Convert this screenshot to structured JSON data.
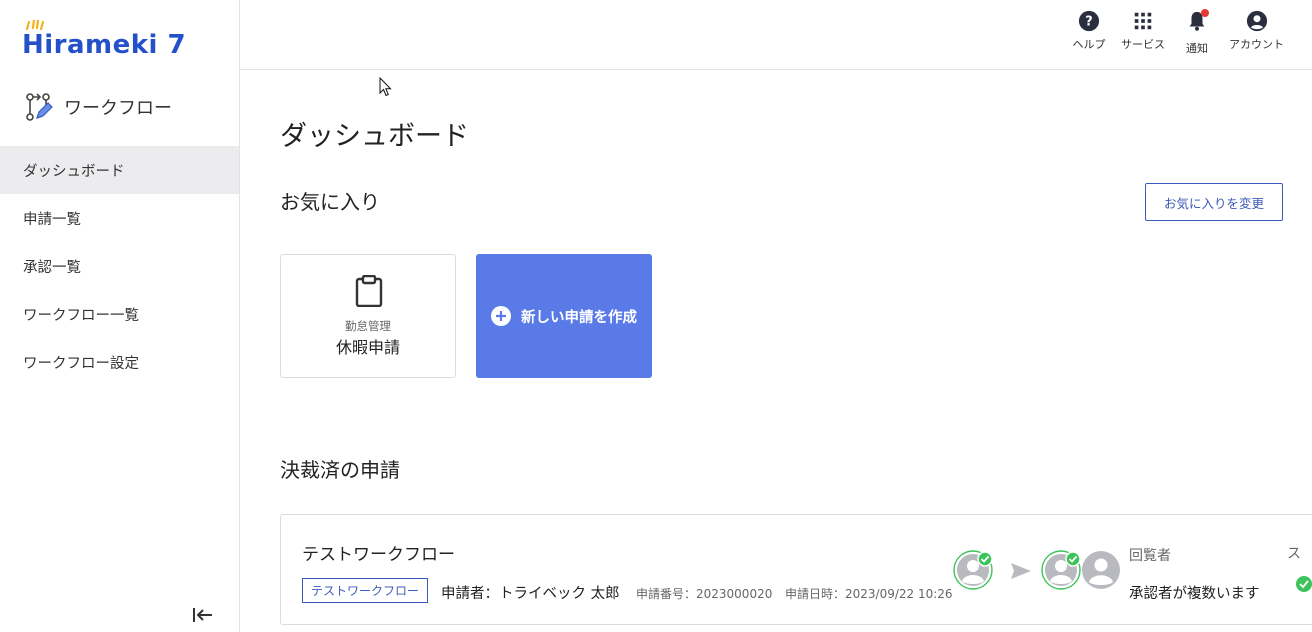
{
  "brand": {
    "logo_text": "Hirameki 7",
    "app_name": "ワークフロー"
  },
  "sidebar": {
    "items": [
      {
        "label": "ダッシュボード",
        "active": true
      },
      {
        "label": "申請一覧"
      },
      {
        "label": "承認一覧"
      },
      {
        "label": "ワークフロー一覧"
      },
      {
        "label": "ワークフロー設定"
      }
    ],
    "collapse_icon": "collapse-left-icon"
  },
  "header": {
    "help_label": "ヘルプ",
    "services_label": "サービス",
    "notifications_label": "通知",
    "account_label": "アカウント",
    "notification_dot_color": "#e53935"
  },
  "main": {
    "page_title": "ダッシュボード",
    "favorites": {
      "title": "お気に入り",
      "change_button": "お気に入りを変更",
      "cards": [
        {
          "category": "勤怠管理",
          "name": "休暇申請",
          "icon": "clipboard-icon"
        }
      ],
      "new_request_label": "新しい申請を作成"
    },
    "completed": {
      "title": "決裁済の申請",
      "items": [
        {
          "title": "テストワークフロー",
          "tag": "テストワークフロー",
          "applicant": "申請者：トライベック 太郎",
          "request_number": "申請番号：2023000020",
          "request_datetime": "申請日時：2023/09/22 10:26",
          "viewer_label": "回覧者",
          "viewer_value": "承認者が複数います",
          "status_label_partial": "ス"
        }
      ]
    }
  },
  "colors": {
    "brand_blue": "#2450c9",
    "accent_blue": "#5a7ae8",
    "outline_blue": "#3c5bb8",
    "approved_green": "#3cc45a"
  }
}
